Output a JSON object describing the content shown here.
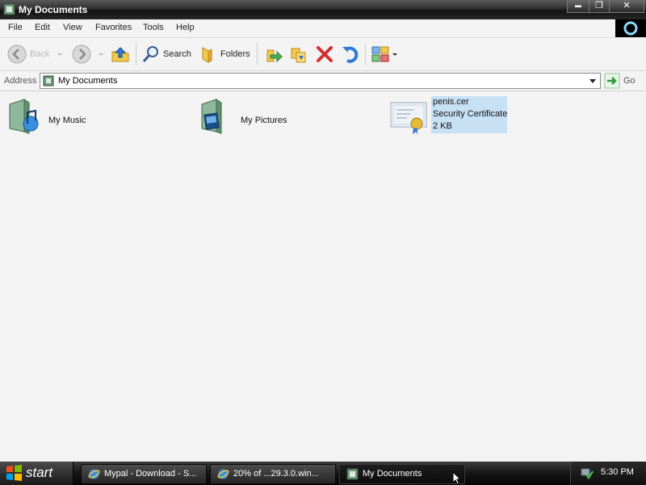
{
  "window": {
    "title": "My Documents",
    "controls": {
      "minimize": "▬",
      "maximize": "❐",
      "close": "✕"
    },
    "brand_icon": "ring-logo-icon"
  },
  "menu": {
    "items": [
      "File",
      "Edit",
      "View",
      "Favorites",
      "Tools",
      "Help"
    ]
  },
  "toolbar": {
    "back_label": "Back",
    "search_label": "Search",
    "folders_label": "Folders"
  },
  "address": {
    "label": "Address",
    "value": "My Documents",
    "go_label": "Go"
  },
  "content": {
    "items": [
      {
        "name": "My Music",
        "icon": "music-folder-icon"
      },
      {
        "name": "My Pictures",
        "icon": "pictures-folder-icon"
      },
      {
        "name": "penis.cer",
        "type": "Security Certificate",
        "size": "2 KB",
        "icon": "certificate-icon",
        "selected": true
      }
    ]
  },
  "taskbar": {
    "start_label": "start",
    "tasks": [
      {
        "label": "Mypal - Download - S...",
        "icon": "browser-icon",
        "active": false
      },
      {
        "label": "20% of ...29.3.0.win...",
        "icon": "browser-icon",
        "active": false
      },
      {
        "label": "My Documents",
        "icon": "folder-window-icon",
        "active": true
      }
    ],
    "clock": "5:30 PM"
  },
  "colors": {
    "selection": "#c7e0f4",
    "window_bg": "#f3f3f3",
    "titlebar": "#2e2e2e",
    "taskbar": "#151515"
  }
}
